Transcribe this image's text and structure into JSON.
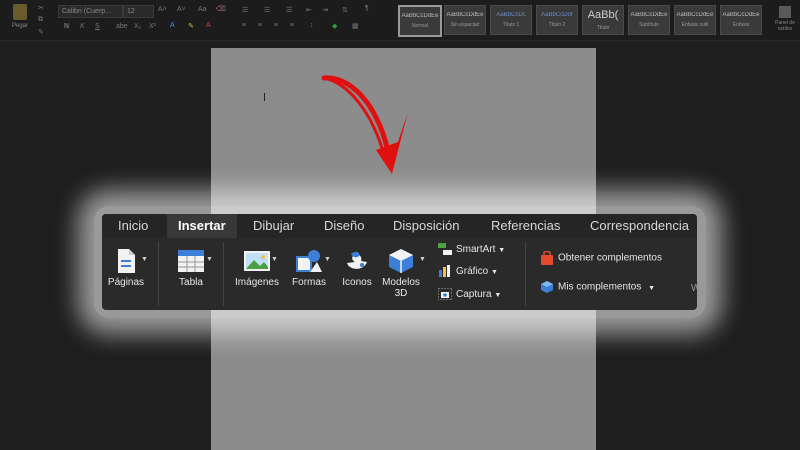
{
  "toolbar": {
    "paste_label": "Pegar",
    "font_name": "Calibri (Cuerp...",
    "font_size": "12",
    "styles": [
      {
        "sample": "AaBbCcDdEe",
        "name": "Normal"
      },
      {
        "sample": "AaBbCcDdEe",
        "name": "Sin espaciad"
      },
      {
        "sample": "AaBbCcDc",
        "name": "Título 1"
      },
      {
        "sample": "AaBbCcDdr",
        "name": "Título 2"
      },
      {
        "sample": "AaBb(",
        "name": "Título"
      },
      {
        "sample": "AaBbCcDdEe",
        "name": "Subtítulo"
      },
      {
        "sample": "AaBbCcDdEe",
        "name": "Énfasis sutil"
      },
      {
        "sample": "AaBbCcDdEe",
        "name": "Énfasis"
      }
    ],
    "styles_pane_label": "Panel de estilos"
  },
  "ribbon": {
    "tabs": [
      "Inicio",
      "Insertar",
      "Dibujar",
      "Diseño",
      "Disposición",
      "Referencias",
      "Correspondencia"
    ],
    "active_tab": "Insertar",
    "buttons": {
      "paginas": "Páginas",
      "tabla": "Tabla",
      "imagenes": "Imágenes",
      "formas": "Formas",
      "iconos": "Iconos",
      "modelos_line1": "Modelos",
      "modelos_line2": "3D",
      "smartart": "SmartArt",
      "grafico": "Gráfico",
      "captura": "Captura",
      "obtener": "Obtener complementos",
      "mis": "Mis complementos",
      "w": "W"
    }
  },
  "colors": {
    "background": "#1e1e1e",
    "page": "#8c8c8c",
    "arrow": "#e01010",
    "ribbon": "#2a2a2a"
  }
}
